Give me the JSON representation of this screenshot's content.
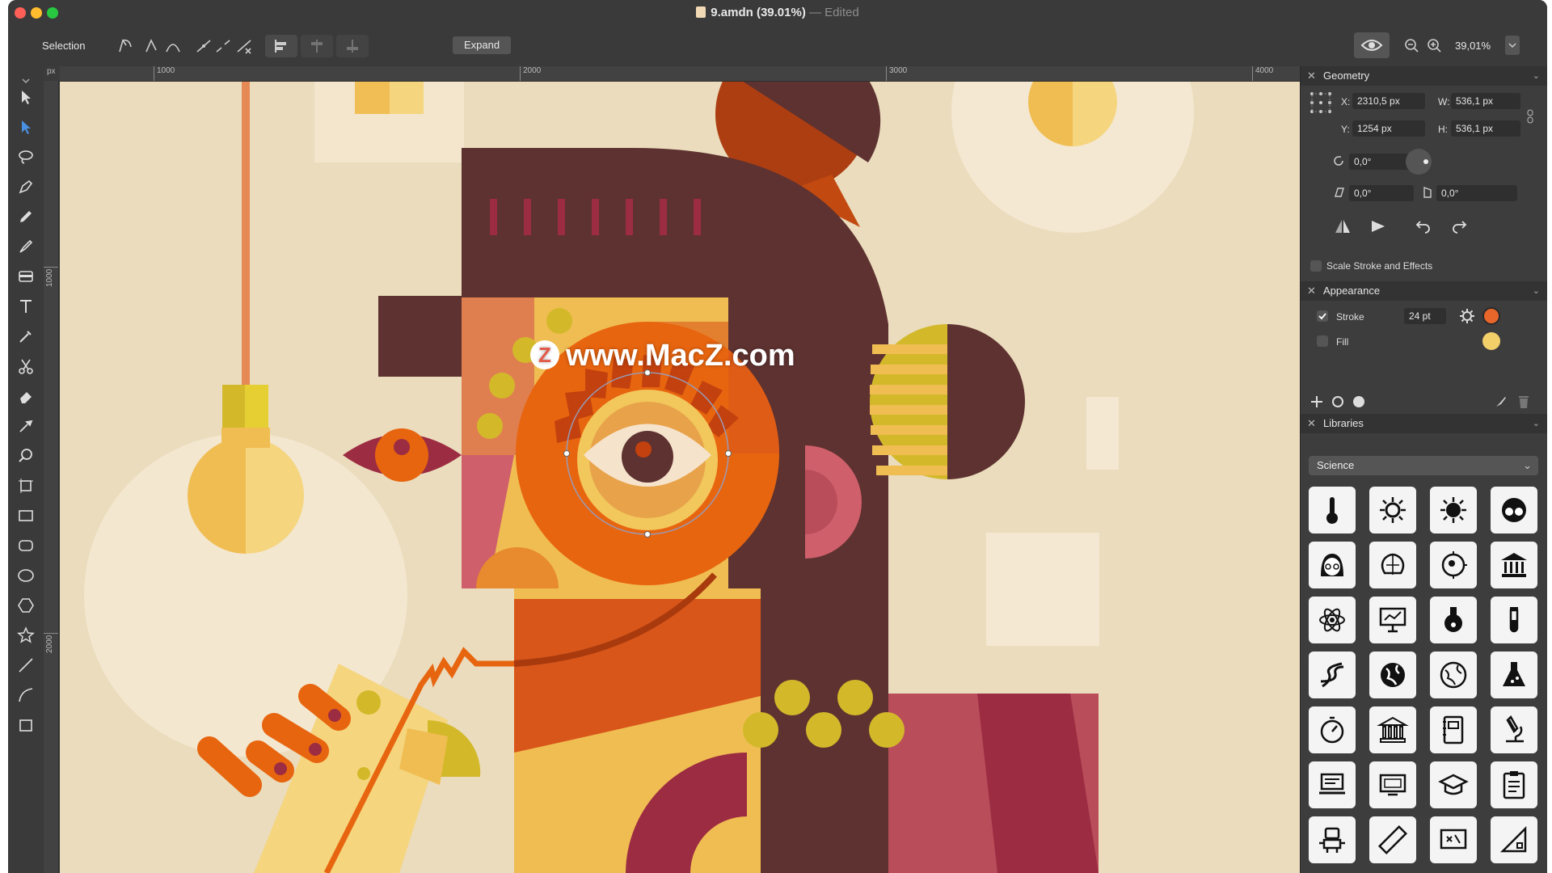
{
  "window": {
    "title": "9.amdn (39.01%)",
    "title_separator": "—",
    "title_status": "Edited"
  },
  "toolbar": {
    "tool_name": "Selection",
    "expand_label": "Expand",
    "zoom_value": "39,01%"
  },
  "ruler": {
    "unit": "px",
    "top_ticks": [
      "1000",
      "2000",
      "3000",
      "4000"
    ],
    "left_ticks": [
      "1000",
      "2000"
    ]
  },
  "watermark": {
    "badge": "Z",
    "text": "www.MacZ.com"
  },
  "panel": {
    "geometry": {
      "title": "Geometry",
      "x_label": "X:",
      "x_value": "2310,5 px",
      "y_label": "Y:",
      "y_value": "1254 px",
      "w_label": "W:",
      "w_value": "536,1 px",
      "h_label": "H:",
      "h_value": "536,1 px",
      "rotation_value": "0,0°",
      "skew_value": "0,0°",
      "shear_value": "0,0°",
      "scale_stroke_label": "Scale Stroke and Effects"
    },
    "appearance": {
      "title": "Appearance",
      "stroke_label": "Stroke",
      "stroke_value": "24 pt",
      "stroke_color": "#e8662a",
      "fill_label": "Fill",
      "fill_color": "#f3cf6a"
    },
    "libraries": {
      "title": "Libraries",
      "selected": "Science",
      "icons": [
        "thermometer-icon",
        "virus-icon",
        "bacteria-icon",
        "scientist-glasses-icon",
        "woman-scientist-icon",
        "brain-icon",
        "cell-icon",
        "museum-icon",
        "atom-icon",
        "presentation-board-icon",
        "flask-round-icon",
        "test-tube-icon",
        "dna-icon",
        "globe-icon",
        "earth-icon",
        "erlenmeyer-flask-icon",
        "stopwatch-icon",
        "institution-icon",
        "notebook-icon",
        "microscope-icon",
        "laptop-chart-icon",
        "monitor-icon",
        "graduation-cap-icon",
        "clipboard-icon",
        "robot-icon",
        "ruler-icon",
        "formula-board-icon",
        "set-square-icon"
      ]
    }
  },
  "colors": {
    "accent": "#e8662a",
    "canvas_bg": "#eadcbc",
    "panel_bg": "#3d3d3d",
    "dark_brown": "#5e3230",
    "orange": "#e8650f",
    "yellow": "#f2c75c"
  }
}
